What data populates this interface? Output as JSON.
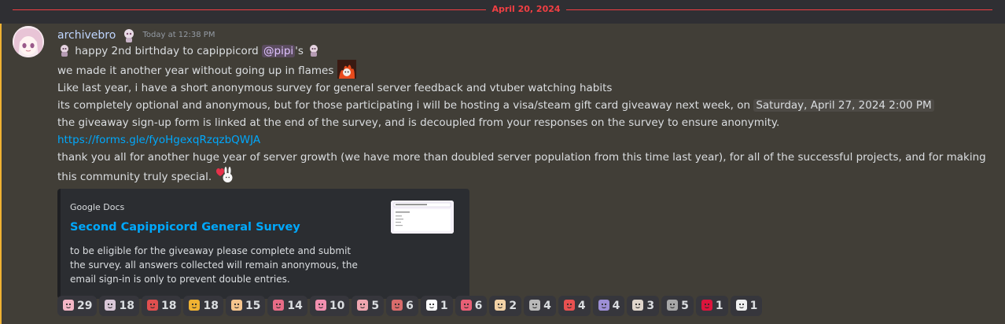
{
  "date_separator": "April 20, 2024",
  "message": {
    "author": "archivebro",
    "timestamp": "Today at 12:38 PM",
    "line1_pre": " happy 2nd birthday to capippicord ",
    "mention": "@pipi",
    "line1_post": "'s ",
    "line2": "we made it another year without going up in flames ",
    "line3": "Like last year, i have a short anonymous survey for general server feedback and vtuber watching habits",
    "line4": "its completely optional and anonymous, but for those participating i will be hosting a visa/steam gift card giveaway next week, on ",
    "line4_timestamp": "Saturday, April 27, 2024 2:00 PM",
    "line5": "the giveaway sign-up form is linked at the end of the survey, and is decoupled from your responses on the survey to ensure anonymity.",
    "link": "https://forms.gle/fyoHgexqRzqzbQWJA",
    "line7": "thank you all for another huge year of server growth (we have more than doubled server population from this time last year), for all of the successful projects, and for making this community truly special. "
  },
  "embed": {
    "provider": "Google Docs",
    "title": "Second Capippicord General Survey",
    "description": "to be eligible for the giveaway please complete and submit the survey. all answers collected will remain anonymous, the email sign-in is only to prevent double entries."
  },
  "reactions": [
    {
      "icon": "face-emoji",
      "color": "#f4b6c6",
      "count": "29"
    },
    {
      "icon": "chibi-emoji",
      "color": "#d9c7d8",
      "count": "18"
    },
    {
      "icon": "red-emoji",
      "color": "#e04f4f",
      "count": "18"
    },
    {
      "icon": "party-popper-emoji",
      "color": "#f0b232",
      "count": "18"
    },
    {
      "icon": "cheer-emoji",
      "color": "#f6c58d",
      "count": "15"
    },
    {
      "icon": "heart-girl-emoji",
      "color": "#e86b86",
      "count": "14"
    },
    {
      "icon": "cake-emoji",
      "color": "#f28fb0",
      "count": "10"
    },
    {
      "icon": "bell-emoji",
      "color": "#f0a6b0",
      "count": "5"
    },
    {
      "icon": "blob-emoji",
      "color": "#d96b6b",
      "count": "6"
    },
    {
      "icon": "bunny-card-emoji",
      "color": "#ffffff",
      "count": "1"
    },
    {
      "icon": "heart-bunny-emoji",
      "color": "#e95f75",
      "count": "6"
    },
    {
      "icon": "sticker-emoji",
      "color": "#f3d2a6",
      "count": "2"
    },
    {
      "icon": "gray-creature-emoji",
      "color": "#b9b9b9",
      "count": "4"
    },
    {
      "icon": "red-card-emoji",
      "color": "#e85050",
      "count": "4"
    },
    {
      "icon": "purple-chibi-emoji",
      "color": "#9d8fd6",
      "count": "4"
    },
    {
      "icon": "reading-emoji",
      "color": "#e0d6cc",
      "count": "3"
    },
    {
      "icon": "gray-creature-emoji",
      "color": "#a8a8a8",
      "count": "5"
    },
    {
      "icon": "poland-flag-emoji",
      "color": "#dc143c",
      "count": "1"
    },
    {
      "icon": "heart-bunny-emoji",
      "color": "#f0f0f0",
      "count": "1"
    }
  ]
}
